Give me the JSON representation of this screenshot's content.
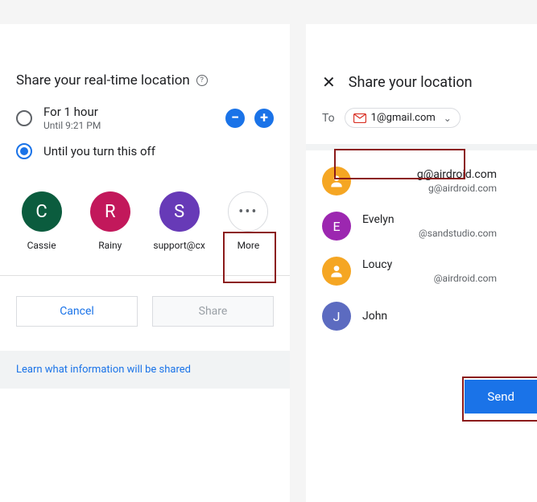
{
  "left": {
    "title": "Share your real-time location",
    "options": {
      "hour": {
        "label": "For 1 hour",
        "sub": "Until 9:21 PM"
      },
      "until_off": {
        "label": "Until you turn this off"
      }
    },
    "contacts": [
      {
        "initial": "C",
        "name": "Cassie",
        "color": "#0b5c3e"
      },
      {
        "initial": "R",
        "name": "Rainy",
        "color": "#c2185b"
      },
      {
        "initial": "S",
        "name": "support@cx",
        "color": "#673ab7"
      }
    ],
    "more_label": "More",
    "cancel_label": "Cancel",
    "share_label": "Share",
    "info_text": "Learn what information will be shared"
  },
  "right": {
    "title": "Share your location",
    "to_label": "To",
    "chip": "1@gmail.com",
    "contacts": [
      {
        "initial": "",
        "name": "",
        "email": "g@airdroid.com",
        "email2": "g@airdroid.com",
        "color": "#f5a623",
        "icon": "person"
      },
      {
        "initial": "E",
        "name": "Evelyn",
        "email": "@sandstudio.com",
        "color": "#9c27b0"
      },
      {
        "initial": "",
        "name": "Loucy",
        "email": "@airdroid.com",
        "color": "#f5a623",
        "icon": "person"
      },
      {
        "initial": "J",
        "name": "John",
        "email": "",
        "color": "#5c6bc0"
      }
    ],
    "send_label": "Send"
  }
}
